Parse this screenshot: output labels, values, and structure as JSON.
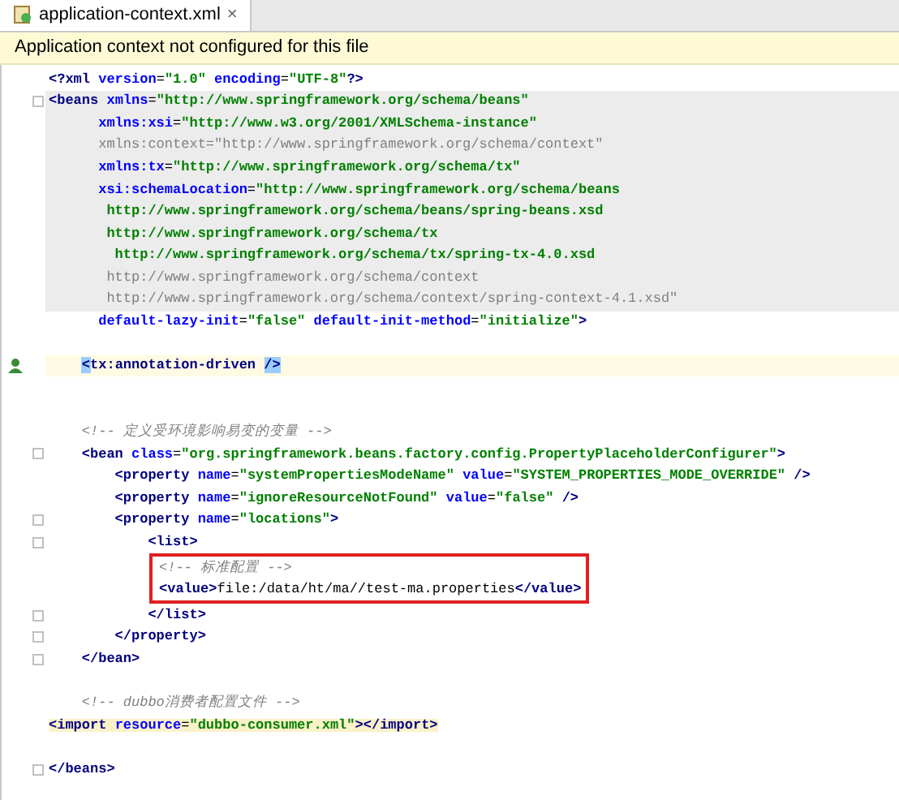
{
  "tab": {
    "title": "application-context.xml",
    "close": "×",
    "selected": true
  },
  "banner": "Application context not configured for this file",
  "lines": [
    {
      "kind": "code",
      "segments": [
        {
          "kind": "tag",
          "text": "<?xml "
        },
        {
          "kind": "attr",
          "text": "version"
        },
        {
          "kind": "text",
          "text": "="
        },
        {
          "kind": "value",
          "text": "\"1.0\" "
        },
        {
          "kind": "attr",
          "text": "encoding"
        },
        {
          "kind": "text",
          "text": "="
        },
        {
          "kind": "value",
          "text": "\"UTF-8\""
        },
        {
          "kind": "tag",
          "text": "?>"
        }
      ]
    },
    {
      "kind": "code",
      "shaded": true,
      "fold": true,
      "segments": [
        {
          "kind": "tag",
          "text": "<beans "
        },
        {
          "kind": "attr",
          "text": "xmlns"
        },
        {
          "kind": "text",
          "text": "="
        },
        {
          "kind": "value",
          "text": "\"http://www.springframework.org/schema/beans\""
        }
      ]
    },
    {
      "kind": "code",
      "shaded": true,
      "segments": [
        {
          "kind": "attr",
          "text": "      xmlns:xsi"
        },
        {
          "kind": "text",
          "text": "="
        },
        {
          "kind": "value",
          "text": "\"http://www.w3.org/2001/XMLSchema-instance\""
        }
      ]
    },
    {
      "kind": "code",
      "shaded": true,
      "segments": [
        {
          "kind": "unused",
          "text": "      xmlns:context=\"http://www.springframework.org/schema/context\""
        }
      ]
    },
    {
      "kind": "code",
      "shaded": true,
      "segments": [
        {
          "kind": "attr",
          "text": "      xmlns:tx"
        },
        {
          "kind": "text",
          "text": "="
        },
        {
          "kind": "value",
          "text": "\"http://www.springframework.org/schema/tx\""
        }
      ]
    },
    {
      "kind": "code",
      "shaded": true,
      "segments": [
        {
          "kind": "attr",
          "text": "      xsi:schemaLocation"
        },
        {
          "kind": "text",
          "text": "="
        },
        {
          "kind": "value",
          "text": "\"http://www.springframework.org/schema/beans"
        }
      ]
    },
    {
      "kind": "code",
      "shaded": true,
      "segments": [
        {
          "kind": "value",
          "text": "       http://www.springframework.org/schema/beans/spring-beans.xsd"
        }
      ]
    },
    {
      "kind": "code",
      "shaded": true,
      "segments": [
        {
          "kind": "value",
          "text": "       http://www.springframework.org/schema/tx"
        }
      ]
    },
    {
      "kind": "code",
      "shaded": true,
      "segments": [
        {
          "kind": "value",
          "text": "        http://www.springframework.org/schema/tx/spring-tx-4.0.xsd"
        }
      ]
    },
    {
      "kind": "code",
      "shaded": true,
      "segments": [
        {
          "kind": "unused",
          "text": "       http://www.springframework.org/schema/context"
        }
      ]
    },
    {
      "kind": "code",
      "shaded": true,
      "segments": [
        {
          "kind": "unused",
          "text": "       http://www.springframework.org/schema/context/spring-context-4.1.xsd\""
        }
      ]
    },
    {
      "kind": "code",
      "segments": [
        {
          "kind": "attr",
          "text": "      default-lazy-init"
        },
        {
          "kind": "text",
          "text": "="
        },
        {
          "kind": "value",
          "text": "\"false\" "
        },
        {
          "kind": "attr",
          "text": "default-init-method"
        },
        {
          "kind": "text",
          "text": "="
        },
        {
          "kind": "value",
          "text": "\"initialize\""
        },
        {
          "kind": "tag",
          "text": ">"
        }
      ]
    },
    {
      "kind": "blank"
    },
    {
      "kind": "code",
      "current": true,
      "marker": true,
      "segments": [
        {
          "kind": "brace",
          "text": "    <"
        },
        {
          "kind": "tag",
          "text": "tx:annotation-driven "
        },
        {
          "kind": "brace",
          "text": "/>"
        }
      ]
    },
    {
      "kind": "blank"
    },
    {
      "kind": "blank"
    },
    {
      "kind": "code",
      "segments": [
        {
          "kind": "comment",
          "text": "    <!-- 定义受环境影响易变的变量 -->"
        }
      ]
    },
    {
      "kind": "code",
      "fold": true,
      "segments": [
        {
          "kind": "tag",
          "text": "    <bean "
        },
        {
          "kind": "attr",
          "text": "class"
        },
        {
          "kind": "text",
          "text": "="
        },
        {
          "kind": "value",
          "text": "\"org.springframework.beans.factory.config.PropertyPlaceholderConfigurer\""
        },
        {
          "kind": "tag",
          "text": ">"
        }
      ]
    },
    {
      "kind": "code",
      "segments": [
        {
          "kind": "tag",
          "text": "        <property "
        },
        {
          "kind": "attr",
          "text": "name"
        },
        {
          "kind": "text",
          "text": "="
        },
        {
          "kind": "value",
          "text": "\"systemPropertiesModeName\" "
        },
        {
          "kind": "attr",
          "text": "value"
        },
        {
          "kind": "text",
          "text": "="
        },
        {
          "kind": "value",
          "text": "\"SYSTEM_PROPERTIES_MODE_OVERRIDE\" "
        },
        {
          "kind": "tag",
          "text": "/>"
        }
      ]
    },
    {
      "kind": "code",
      "segments": [
        {
          "kind": "tag",
          "text": "        <property "
        },
        {
          "kind": "attr",
          "text": "name"
        },
        {
          "kind": "text",
          "text": "="
        },
        {
          "kind": "value",
          "text": "\"ignoreResourceNotFound\" "
        },
        {
          "kind": "attr",
          "text": "value"
        },
        {
          "kind": "text",
          "text": "="
        },
        {
          "kind": "value",
          "text": "\"false\" "
        },
        {
          "kind": "tag",
          "text": "/>"
        }
      ]
    },
    {
      "kind": "code",
      "fold": true,
      "segments": [
        {
          "kind": "tag",
          "text": "        <property "
        },
        {
          "kind": "attr",
          "text": "name"
        },
        {
          "kind": "text",
          "text": "="
        },
        {
          "kind": "value",
          "text": "\"locations\""
        },
        {
          "kind": "tag",
          "text": ">"
        }
      ]
    },
    {
      "kind": "code",
      "fold": true,
      "segments": [
        {
          "kind": "tag",
          "text": "            <list>"
        }
      ]
    },
    {
      "kind": "code",
      "boxed": true,
      "segments": [
        {
          "kind": "comment",
          "text": "<!-- 标准配置 -->"
        }
      ]
    },
    {
      "kind": "code",
      "boxed": true,
      "segments": [
        {
          "kind": "tag",
          "text": "<value>"
        },
        {
          "kind": "text",
          "text": "file:/data/ht/ma//test-ma.properties"
        },
        {
          "kind": "tag",
          "text": "</value>"
        }
      ]
    },
    {
      "kind": "code",
      "fold": true,
      "segments": [
        {
          "kind": "tag",
          "text": "            </list>"
        }
      ]
    },
    {
      "kind": "code",
      "fold": true,
      "segments": [
        {
          "kind": "tag",
          "text": "        </property>"
        }
      ]
    },
    {
      "kind": "code",
      "fold": true,
      "segments": [
        {
          "kind": "tag",
          "text": "    </bean>"
        }
      ]
    },
    {
      "kind": "blank"
    },
    {
      "kind": "code",
      "segments": [
        {
          "kind": "comment",
          "text": "    <!-- dubbo消费者配置文件 -->"
        }
      ]
    },
    {
      "kind": "code",
      "matched": true,
      "segments": [
        {
          "kind": "tag",
          "text": "<import "
        },
        {
          "kind": "attr",
          "text": "resource"
        },
        {
          "kind": "text",
          "text": "="
        },
        {
          "kind": "value",
          "text": "\"dubbo-consumer.xml\""
        },
        {
          "kind": "tag",
          "text": "></import>"
        }
      ]
    },
    {
      "kind": "blank"
    },
    {
      "kind": "code",
      "fold": true,
      "segments": [
        {
          "kind": "tag",
          "text": "</beans>"
        }
      ]
    }
  ]
}
